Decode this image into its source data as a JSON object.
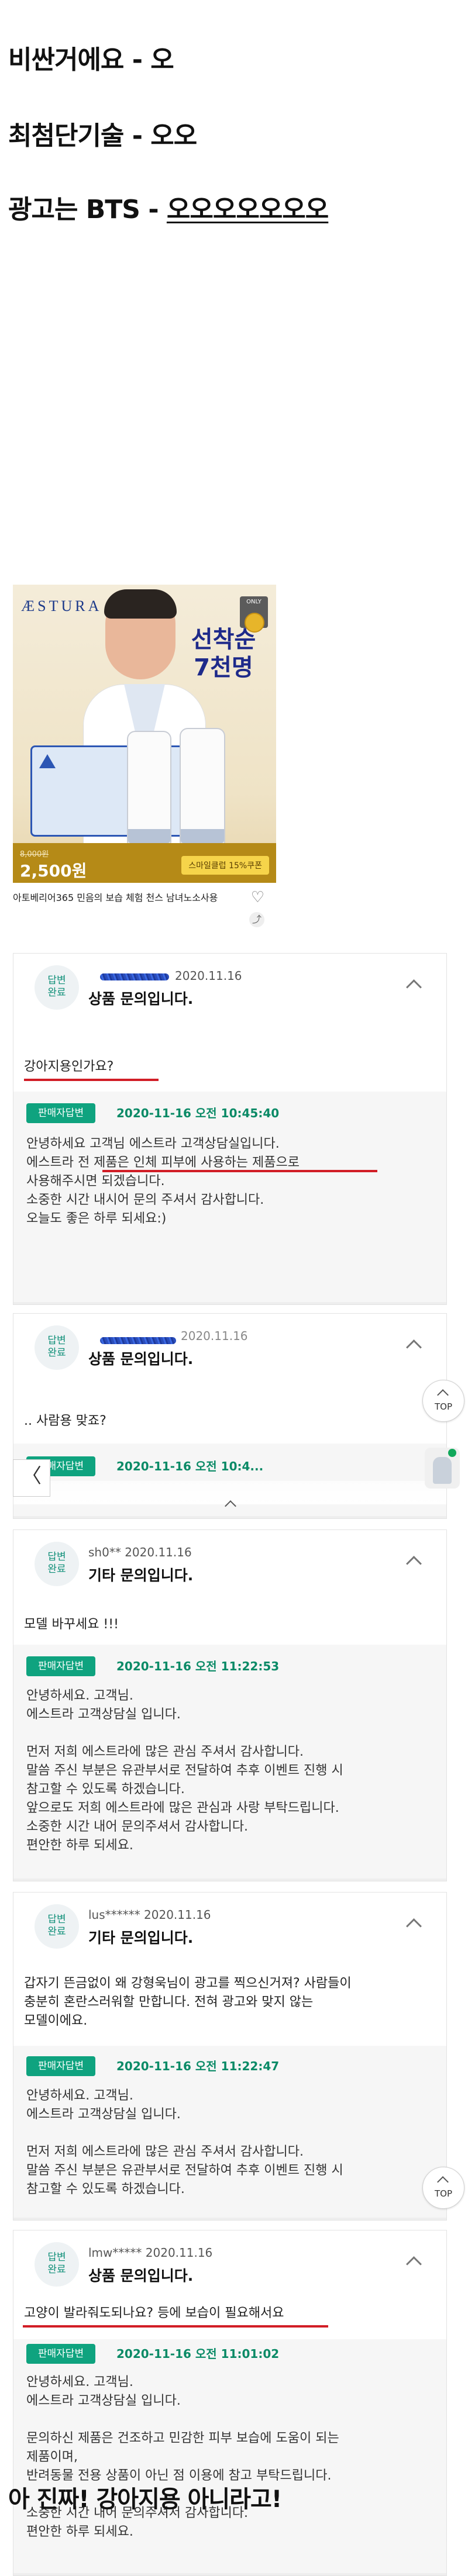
{
  "headlines": {
    "line1": "비싼거에요 - 오",
    "line2": "최첨단기술 - 오오",
    "line3_prefix": "광고는 BTS - ",
    "line3_emph": "오오오오오오오",
    "closing": "아 진짜! 강아지용 아니라고!"
  },
  "product": {
    "brand_logo": "ÆSTURA",
    "badge_text": "ONLY",
    "ad_headline_line1": "선착순",
    "ad_headline_line2": "7천명",
    "price_original": "8,000원",
    "price": "2,500원",
    "coupon": "스마일클럽 15%쿠폰",
    "name": "아토베리어365 민음의 보습 체험 천스 남녀노소사용",
    "heart_icon": "heart-outline",
    "share_icon": "share"
  },
  "qa": [
    {
      "status_label": "답변\n완료",
      "author": "",
      "date": "2020.11.16",
      "type": "상품 문의입니다.",
      "question": "강아지용인가요?",
      "seller_badge": "판매자답변",
      "answer_date": "2020-11-16 오전 10:45:40",
      "answer_lines": [
        "안녕하세요 고객님 에스트라 고객상담실입니다.",
        "에스트라 전 제품은 인체 피부에 사용하는 제품으로",
        "사용해주시면 되겠습니다.",
        "소중한 시간 내시어 문의 주셔서 감사합니다.",
        "오늘도 좋은 하루 되세요:)"
      ]
    },
    {
      "status_label": "답변\n완료",
      "author": "",
      "date": "2020.11.16",
      "type": "상품 문의입니다.",
      "question": ".. 사람용 맞죠?",
      "seller_badge": "판매자답변",
      "answer_date": "2020-11-16 오전 10:4..."
    },
    {
      "status_label": "답변\n완료",
      "author": "sh0**",
      "date": "2020.11.16",
      "type": "기타 문의입니다.",
      "question": "모델 바꾸세요 !!!",
      "seller_badge": "판매자답변",
      "answer_date": "2020-11-16 오전 11:22:53",
      "answer_lines": [
        "안녕하세요. 고객님.",
        "에스트라 고객상담실 입니다.",
        "",
        "먼저 저희 에스트라에 많은 관심 주셔서 감사합니다.",
        "말씀 주신 부분은 유관부서로 전달하여 추후 이벤트 진행 시",
        "참고할 수 있도록 하겠습니다.",
        "앞으로도 저희 에스트라에 많은 관심과 사랑 부탁드립니다.",
        "소중한 시간 내어 문의주셔서 감사합니다.",
        "편안한 하루 되세요."
      ]
    },
    {
      "status_label": "답변\n완료",
      "author": "lus******",
      "date": "2020.11.16",
      "type": "기타 문의입니다.",
      "question_lines": [
        "갑자기 뜬금없이 왜 강형욱님이 광고를 찍으신거져? 사람들이",
        "충분히 혼란스러워할 만합니다. 전혀 광고와 맞지 않는",
        "모델이에요."
      ],
      "seller_badge": "판매자답변",
      "answer_date": "2020-11-16 오전 11:22:47",
      "answer_lines": [
        "안녕하세요. 고객님.",
        "에스트라 고객상담실 입니다.",
        "",
        "먼저 저희 에스트라에 많은 관심 주셔서 감사합니다.",
        "말씀 주신 부분은 유관부서로 전달하여 추후 이벤트 진행 시",
        "참고할 수 있도록 하겠습니다."
      ]
    },
    {
      "status_label": "답변\n완료",
      "author": "lmw*****",
      "date": "2020.11.16",
      "type": "상품 문의입니다.",
      "question": "고양이 발라줘도되나요? 등에 보습이 필요해서요",
      "seller_badge": "판매자답변",
      "answer_date": "2020-11-16 오전 11:01:02",
      "answer_lines": [
        "안녕하세요. 고객님.",
        "에스트라 고객상담실 입니다.",
        "",
        "문의하신 제품은 건조하고 민감한 피부 보습에 도움이 되는",
        "제품이며,",
        "반려동물 전용 상품이 아닌 점 이용에 참고 부탁드립니다.",
        "",
        "소중한 시간 내어 문의주셔서 감사합니다.",
        "편안한 하루 되세요."
      ]
    }
  ],
  "ui": {
    "top_label": "TOP",
    "back_glyph": "〈"
  },
  "colors": {
    "accent_green": "#0fa37f",
    "underline_red": "#d11d26",
    "brand_blue": "#1d3a8a"
  }
}
